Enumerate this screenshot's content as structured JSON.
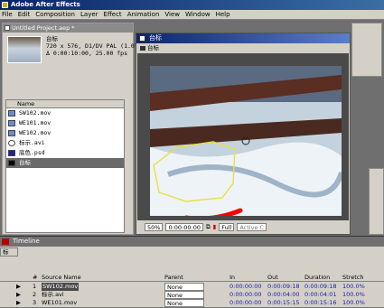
{
  "app": {
    "title": "Adobe After Effects"
  },
  "menu": [
    "File",
    "Edit",
    "Composition",
    "Layer",
    "Effect",
    "Animation",
    "View",
    "Window",
    "Help"
  ],
  "project": {
    "title": "Untitled Project.aep *",
    "comp_name": "台标",
    "info_lines": [
      "720 x 576, D1/DV PAL (1.07",
      "Δ 0:00:10:00, 25.00 fps"
    ],
    "column_name": "Name",
    "items": [
      {
        "name": "SW102.mov",
        "icon": "movie-file-icon"
      },
      {
        "name": "WE101.mov",
        "icon": "movie-file-icon"
      },
      {
        "name": "WE102.mov",
        "icon": "movie-file-icon"
      },
      {
        "name": "标示.avi",
        "icon": "avi-file-icon"
      },
      {
        "name": "底色.psd",
        "icon": "psd-file-icon"
      },
      {
        "name": "台标",
        "icon": "composition-icon",
        "selected": true
      }
    ]
  },
  "comp_window": {
    "title": "台标",
    "tab_label": "台标",
    "zoom": "50%",
    "timecode": "0:00:00:00",
    "resolution": "Full",
    "camera": "Active C"
  },
  "timeline": {
    "title": "Timeline",
    "tab_label": "标",
    "headers": {
      "num": "#",
      "source": "Source Name",
      "parent": "Parent",
      "in": "In",
      "out": "Out",
      "duration": "Duration",
      "stretch": "Stretch"
    },
    "layers": [
      {
        "num": "1",
        "source": "SW102.mov",
        "parent": "None",
        "in": "0:00:00:00",
        "out": "0:00:09:18",
        "duration": "0:00:09:18",
        "stretch": "100.0%",
        "selected": true
      },
      {
        "num": "2",
        "source": "标示.avi",
        "parent": "None",
        "in": "0:00:00:00",
        "out": "0:00:04:00",
        "duration": "0:00:04:01",
        "stretch": "100.0%"
      },
      {
        "num": "3",
        "source": "WE101.mov",
        "parent": "None",
        "in": "0:00:00:00",
        "out": "0:00:15:15",
        "duration": "0:00:15:16",
        "stretch": "100.0%"
      }
    ]
  },
  "colors": {
    "mask": "#e8e040",
    "red_stroke": "#ff0000",
    "titlebar": "#0a246a"
  }
}
